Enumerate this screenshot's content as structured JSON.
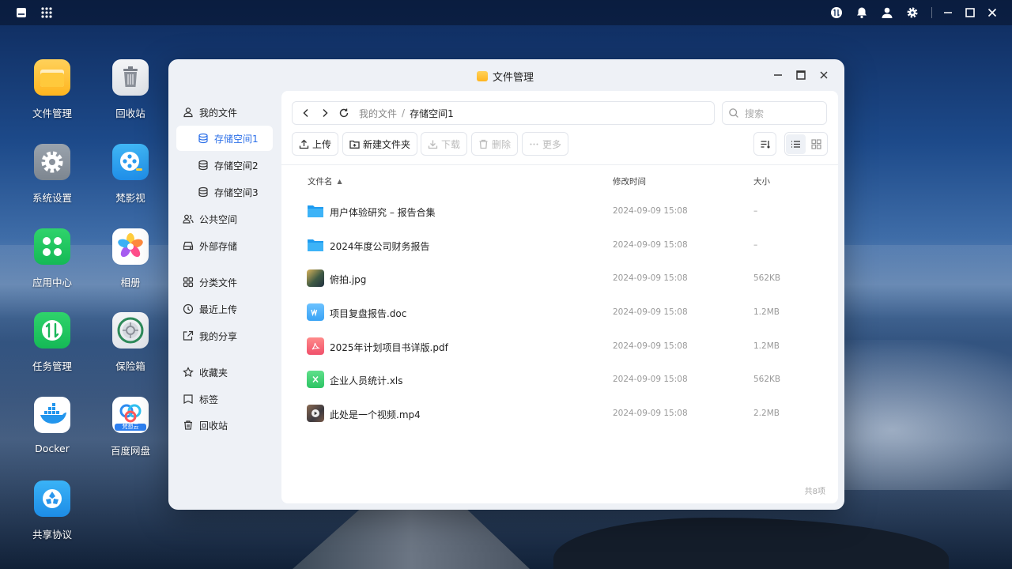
{
  "desktop": {
    "icons": [
      {
        "label": "文件管理",
        "icon": "file-manager-icon"
      },
      {
        "label": "回收站",
        "icon": "trash-icon"
      },
      {
        "label": "系统设置",
        "icon": "settings-icon"
      },
      {
        "label": "梵影视",
        "icon": "video-player-icon"
      },
      {
        "label": "应用中心",
        "icon": "app-center-icon"
      },
      {
        "label": "相册",
        "icon": "photos-icon"
      },
      {
        "label": "任务管理",
        "icon": "task-manager-icon"
      },
      {
        "label": "保险箱",
        "icon": "safe-icon"
      },
      {
        "label": "Docker",
        "icon": "docker-icon"
      },
      {
        "label": "百度网盘",
        "icon": "baidu-netdisk-icon",
        "badge": "梵想云"
      },
      {
        "label": "共享协议",
        "icon": "share-protocol-icon"
      }
    ]
  },
  "window": {
    "title": "文件管理"
  },
  "sidebar": {
    "items": [
      {
        "label": "我的文件",
        "icon": "user-icon"
      },
      {
        "label": "存储空间1",
        "icon": "database-icon",
        "active": true
      },
      {
        "label": "存储空间2",
        "icon": "database-icon"
      },
      {
        "label": "存储空间3",
        "icon": "database-icon"
      },
      {
        "label": "公共空间",
        "icon": "users-icon"
      },
      {
        "label": "外部存储",
        "icon": "drive-icon"
      },
      {
        "label": "分类文件",
        "icon": "grid-icon"
      },
      {
        "label": "最近上传",
        "icon": "clock-icon"
      },
      {
        "label": "我的分享",
        "icon": "share-icon"
      },
      {
        "label": "收藏夹",
        "icon": "star-icon"
      },
      {
        "label": "标签",
        "icon": "tag-icon"
      },
      {
        "label": "回收站",
        "icon": "trash-icon"
      }
    ]
  },
  "breadcrumb": {
    "root": "我的文件",
    "separator": "/",
    "current": "存储空间1"
  },
  "search": {
    "placeholder": "搜索"
  },
  "toolbar": {
    "upload": "上传",
    "new_folder": "新建文件夹",
    "download": "下载",
    "delete": "删除",
    "more": "更多"
  },
  "table": {
    "columns": {
      "name": "文件名",
      "modified": "修改时间",
      "size": "大小"
    },
    "rows": [
      {
        "name": "用户体验研究 – 报告合集",
        "modified": "2024-09-09 15:08",
        "size": "–",
        "type": "folder"
      },
      {
        "name": "2024年度公司财务报告",
        "modified": "2024-09-09 15:08",
        "size": "–",
        "type": "folder"
      },
      {
        "name": "俯拍.jpg",
        "modified": "2024-09-09 15:08",
        "size": "562KB",
        "type": "image"
      },
      {
        "name": "项目复盘报告.doc",
        "modified": "2024-09-09 15:08",
        "size": "1.2MB",
        "type": "doc"
      },
      {
        "name": "2025年计划项目书详版.pdf",
        "modified": "2024-09-09 15:08",
        "size": "1.2MB",
        "type": "pdf"
      },
      {
        "name": "企业人员统计.xls",
        "modified": "2024-09-09 15:08",
        "size": "562KB",
        "type": "xls"
      },
      {
        "name": "此处是一个视频.mp4",
        "modified": "2024-09-09 15:08",
        "size": "2.2MB",
        "type": "video"
      }
    ],
    "total": "共8项"
  }
}
